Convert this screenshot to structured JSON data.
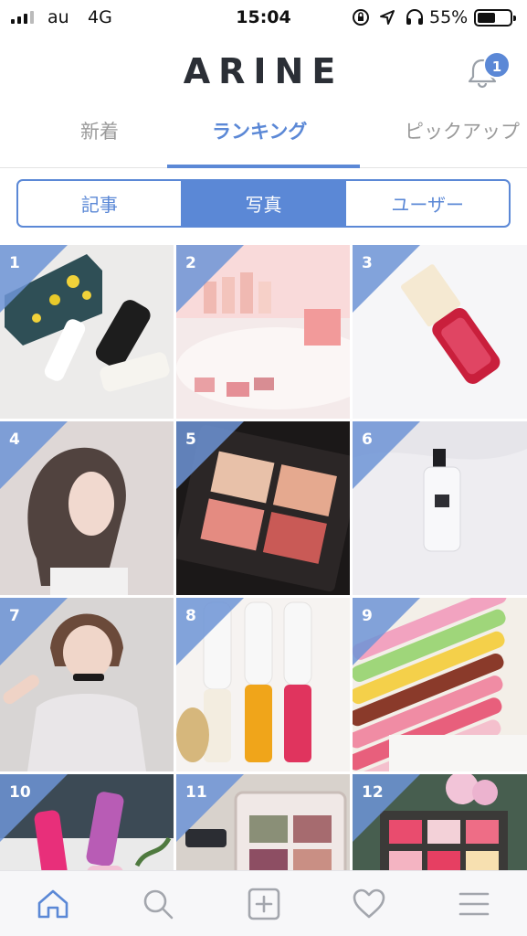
{
  "status_bar": {
    "carrier": "au",
    "network": "4G",
    "time": "15:04",
    "battery_percent": "55%",
    "battery_level": 0.55,
    "icons": [
      "orientation-lock-icon",
      "location-icon",
      "headphones-icon"
    ]
  },
  "header": {
    "logo": "ARINE",
    "notification_count": "1"
  },
  "tabs": [
    {
      "label": "新着"
    },
    {
      "label": "ランキング"
    },
    {
      "label": "ピックアップ"
    }
  ],
  "segmented": [
    {
      "label": "記事"
    },
    {
      "label": "写真"
    },
    {
      "label": "ユーザー"
    }
  ],
  "grid": {
    "items": [
      {
        "rank": "1"
      },
      {
        "rank": "2"
      },
      {
        "rank": "3"
      },
      {
        "rank": "4"
      },
      {
        "rank": "5"
      },
      {
        "rank": "6"
      },
      {
        "rank": "7"
      },
      {
        "rank": "8"
      },
      {
        "rank": "9"
      },
      {
        "rank": "10"
      },
      {
        "rank": "11"
      },
      {
        "rank": "12"
      }
    ]
  },
  "bottom_nav": {
    "icons": [
      "home-icon",
      "search-icon",
      "add-post-icon",
      "favorites-icon",
      "menu-icon"
    ]
  },
  "colors": {
    "accent": "#5b88d6",
    "text_dark": "#2b2f36",
    "inactive": "#9a9a9a"
  }
}
